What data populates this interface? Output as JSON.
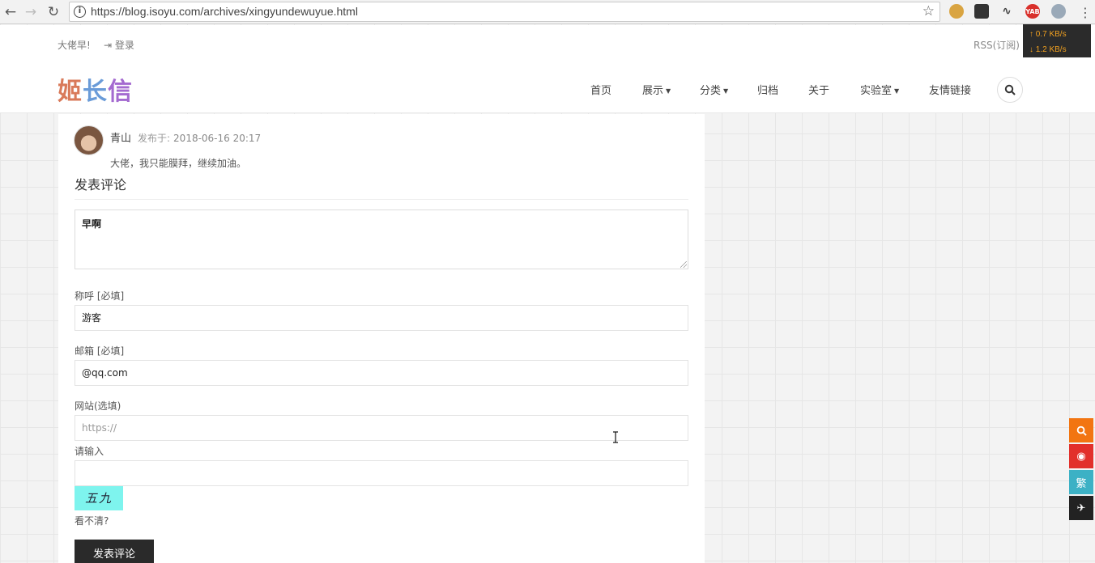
{
  "browser": {
    "url": "https://blog.isoyu.com/archives/xingyundewuyue.html",
    "extensions": [
      "cookie-icon",
      "ghost-icon",
      "pulse-icon",
      "yab-icon",
      "globe-icon"
    ],
    "ext_yab_label": "YAB"
  },
  "speed_widget": {
    "upload": "↑ 0.7 KB/s",
    "download": "↓ 1.2 KB/s"
  },
  "header": {
    "greeting": "大佬早!",
    "login": "登录",
    "rss": "RSS(订阅)",
    "logo_chars": [
      "姬",
      "长",
      "信"
    ],
    "menu": [
      "首页",
      "展示",
      "分类",
      "归档",
      "关于",
      "实验室",
      "友情链接"
    ]
  },
  "comment": {
    "author": "青山",
    "published_label": "发布于:",
    "date": "2018-06-16 20:17",
    "text": "大佬，我只能膜拜，继续加油。"
  },
  "form": {
    "title": "发表评论",
    "content_value": "早啊",
    "name_label": "称呼 [必填]",
    "name_value": "游客",
    "email_label": "邮箱 [必填]",
    "email_value": "@qq.com",
    "site_label": "网站(选填)",
    "site_placeholder": "https://",
    "captcha_label": "请输入",
    "captcha_text": "五九",
    "refresh_label": "看不清?",
    "submit_label": "发表评论"
  },
  "float_tools": {
    "traditional_label": "繁",
    "colors": [
      "#f27511",
      "#e2302b",
      "#3cb1c5",
      "#222222"
    ]
  }
}
